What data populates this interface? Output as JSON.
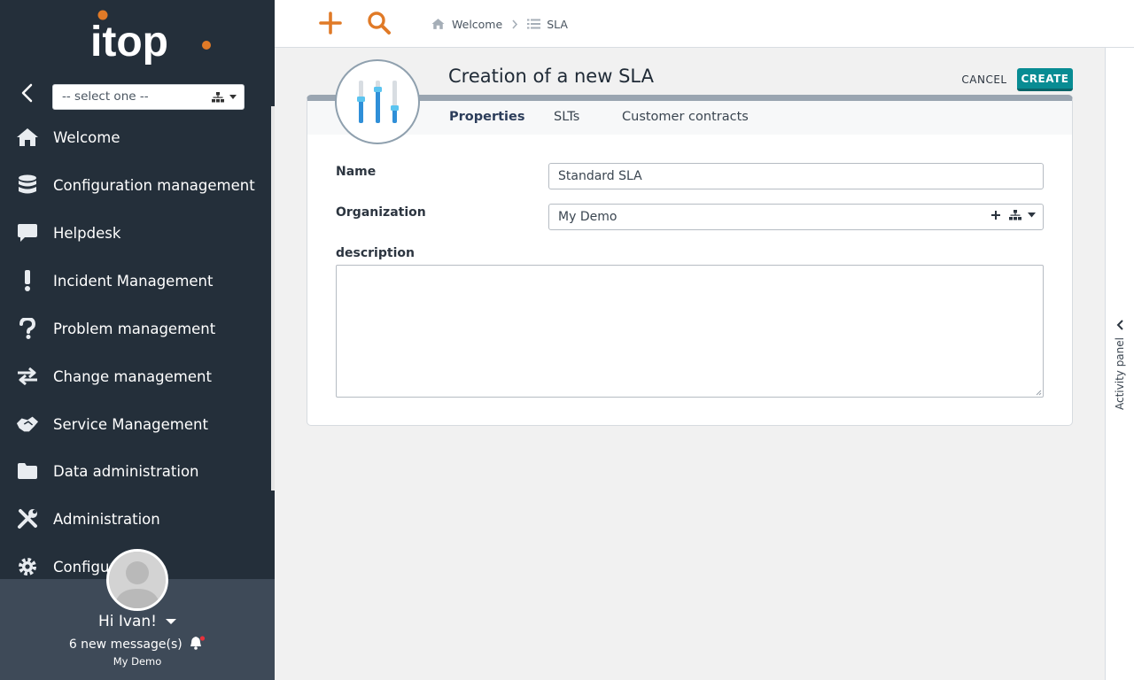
{
  "sidebar": {
    "logo_text": "itop",
    "org_select": {
      "value": "-- select one --"
    },
    "items": [
      {
        "label": "Welcome",
        "icon": "home-icon"
      },
      {
        "label": "Configuration management",
        "icon": "database-icon"
      },
      {
        "label": "Helpdesk",
        "icon": "chat-bubble-icon"
      },
      {
        "label": "Incident Management",
        "icon": "exclamation-icon"
      },
      {
        "label": "Problem management",
        "icon": "question-icon"
      },
      {
        "label": "Change management",
        "icon": "exchange-arrows-icon"
      },
      {
        "label": "Service Management",
        "icon": "handshake-icon"
      },
      {
        "label": "Data administration",
        "icon": "folder-icon"
      },
      {
        "label": "Administration",
        "icon": "tools-icon"
      },
      {
        "label": "Configur",
        "icon": "gear-icon"
      }
    ],
    "user": {
      "greeting": "Hi Ivan!",
      "messages": "6 new message(s)",
      "organization": "My Demo"
    }
  },
  "topbar": {
    "breadcrumb": [
      {
        "label": "Welcome",
        "icon": "home-icon"
      },
      {
        "label": "SLA",
        "icon": "list-icon"
      }
    ]
  },
  "activity_panel": {
    "label": "Activity panel"
  },
  "object": {
    "title": "Creation of a new SLA",
    "actions": {
      "cancel": "CANCEL",
      "create": "CREATE"
    },
    "tabs": [
      "Properties",
      "SLTs",
      "Customer contracts"
    ],
    "active_tab": "Properties",
    "fields": {
      "name": {
        "label": "Name",
        "value": "Standard SLA"
      },
      "organization": {
        "label": "Organization",
        "value": "My Demo"
      },
      "description": {
        "label": "description",
        "value": ""
      }
    }
  },
  "colors": {
    "sidebar_bg": "#242f3a",
    "user_panel_bg": "#3e4a58",
    "accent_orange": "#e07a27",
    "primary_teal": "#088c93",
    "icon_blue": "#2f8fd8"
  }
}
